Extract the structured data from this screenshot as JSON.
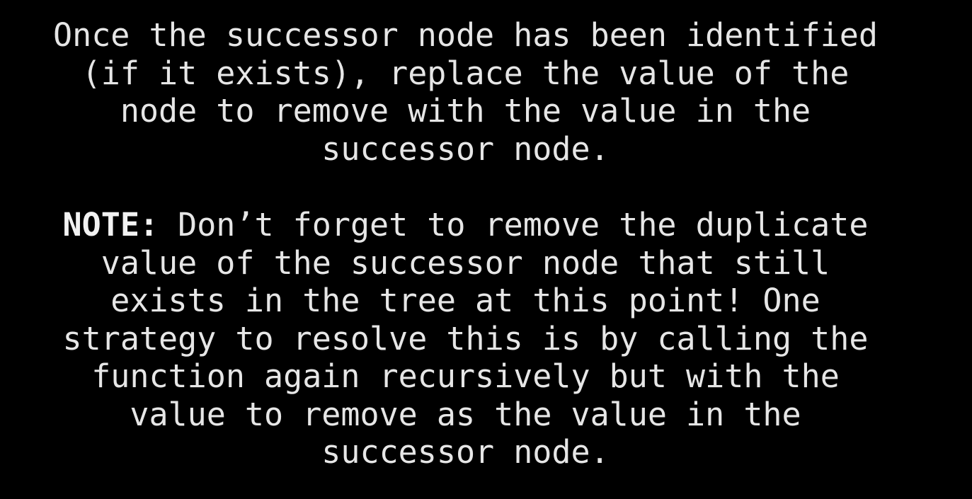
{
  "paragraph_1": {
    "lines": [
      "Once the successor node has been identified",
      "(if it exists), replace the value of the",
      "node to remove with the value in the",
      "successor node."
    ]
  },
  "paragraph_2": {
    "label": "NOTE:",
    "first_line_rest": " Don’t forget to remove the duplicate",
    "lines": [
      "value of the successor node that still",
      "exists in the tree at this point! One",
      "strategy to resolve this is by calling the",
      "function again recursively but with the",
      "value to remove as the value in the",
      "successor node."
    ]
  },
  "colors": {
    "background": "#000000",
    "text": "#e6e6e6"
  }
}
